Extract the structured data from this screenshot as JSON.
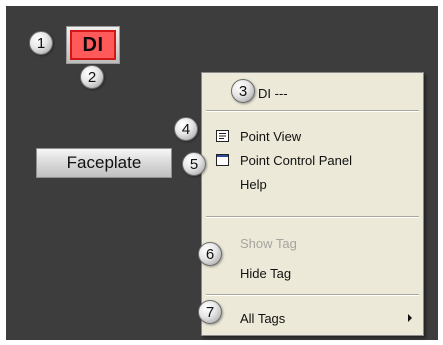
{
  "indicator": {
    "label": "DI"
  },
  "faceplate": {
    "label": "Faceplate"
  },
  "context_menu": {
    "header": "DI ---",
    "items": [
      {
        "label": "Point View",
        "icon": "point-view-icon",
        "enabled": true
      },
      {
        "label": "Point Control Panel",
        "icon": "control-panel-icon",
        "enabled": true
      },
      {
        "label": "Help",
        "enabled": true
      },
      {
        "label": "Show Tag",
        "enabled": false
      },
      {
        "label": "Hide Tag",
        "enabled": true
      },
      {
        "label": "All Tags",
        "submenu": true,
        "enabled": true
      }
    ]
  },
  "callouts": [
    "1",
    "2",
    "3",
    "4",
    "5",
    "6",
    "7"
  ],
  "colors": {
    "background": "#3d3d3d",
    "indicator_fill": "#ff5a5a",
    "indicator_border": "#d51616",
    "menu_bg": "#ece9d8",
    "disabled_text": "#a6a3a0"
  }
}
